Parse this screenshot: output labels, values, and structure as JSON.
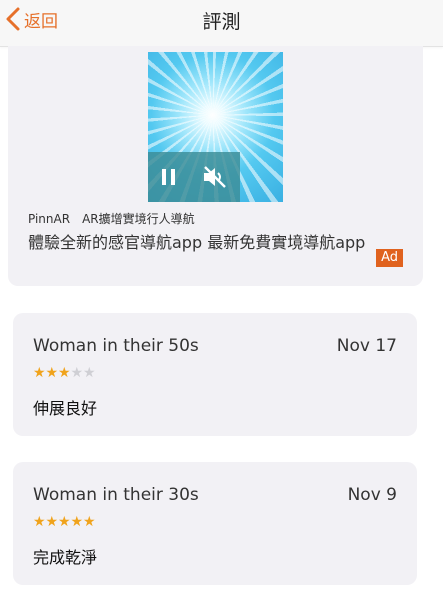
{
  "header": {
    "back_label": "返回",
    "title": "評測"
  },
  "ad": {
    "advertiser": "PinnAR　AR擴增實境行人導航",
    "headline": "體驗全新的感官導航app 最新免費實境導航app",
    "badge": "Ad",
    "video": {
      "state": "paused",
      "muted": true
    }
  },
  "reviews": [
    {
      "reviewer": "Woman in their 50s",
      "date": "Nov 17",
      "rating": 3,
      "max_rating": 5,
      "text": "伸展良好"
    },
    {
      "reviewer": "Woman in their 30s",
      "date": "Nov 9",
      "rating": 5,
      "max_rating": 5,
      "text": "完成乾淨"
    }
  ],
  "colors": {
    "accent": "#e6702a",
    "star_filled": "#f0a31c",
    "star_empty": "#cfcfd4",
    "card_bg": "#f2f1f5",
    "ad_badge": "#e0621e"
  }
}
